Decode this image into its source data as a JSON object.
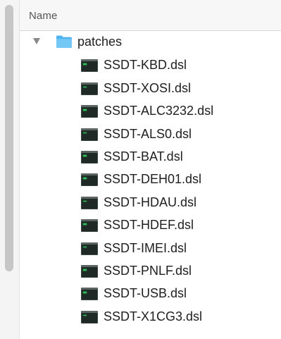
{
  "header": {
    "name_label": "Name"
  },
  "folder": {
    "name": "patches",
    "expanded": true,
    "icon": "folder-icon",
    "color": "#4fb3ee"
  },
  "files": [
    {
      "name": "SSDT-KBD.dsl",
      "icon": "terminal-file-icon"
    },
    {
      "name": "SSDT-XOSI.dsl",
      "icon": "terminal-file-icon"
    },
    {
      "name": "SSDT-ALC3232.dsl",
      "icon": "terminal-file-icon"
    },
    {
      "name": "SSDT-ALS0.dsl",
      "icon": "terminal-file-icon"
    },
    {
      "name": "SSDT-BAT.dsl",
      "icon": "terminal-file-icon"
    },
    {
      "name": "SSDT-DEH01.dsl",
      "icon": "terminal-file-icon"
    },
    {
      "name": "SSDT-HDAU.dsl",
      "icon": "terminal-file-icon"
    },
    {
      "name": "SSDT-HDEF.dsl",
      "icon": "terminal-file-icon"
    },
    {
      "name": "SSDT-IMEI.dsl",
      "icon": "terminal-file-icon"
    },
    {
      "name": "SSDT-PNLF.dsl",
      "icon": "terminal-file-icon"
    },
    {
      "name": "SSDT-USB.dsl",
      "icon": "terminal-file-icon"
    },
    {
      "name": "SSDT-X1CG3.dsl",
      "icon": "terminal-file-icon"
    }
  ]
}
